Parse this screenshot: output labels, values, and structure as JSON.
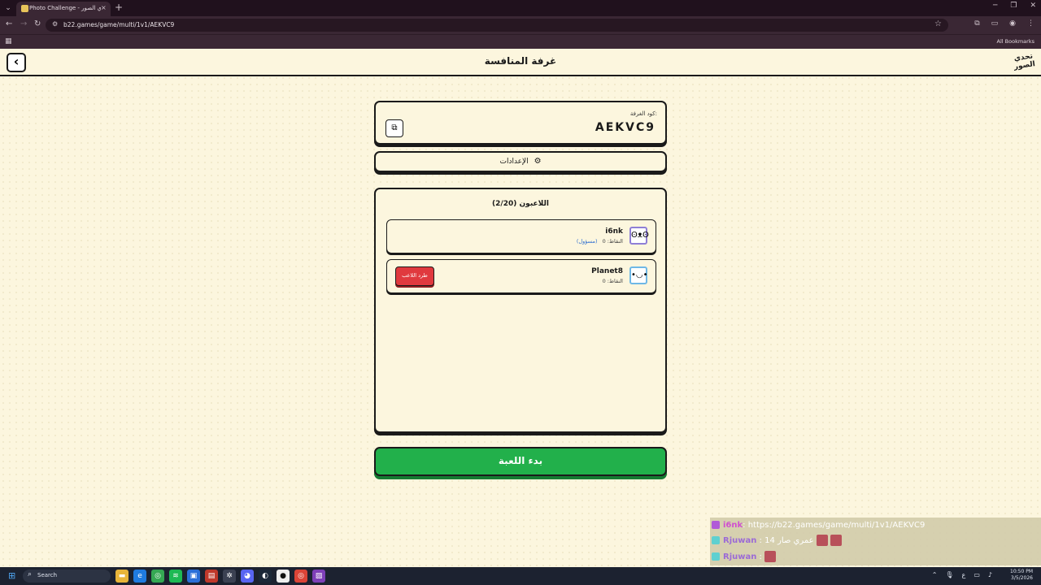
{
  "browser": {
    "tab_title": "Photo Challenge - تحدي الصور",
    "tab_close": "×",
    "new_tab": "+",
    "url": "b22.games/game/multi/1v1/AEKVC9",
    "all_bookmarks": "All Bookmarks"
  },
  "header": {
    "title": "غرفة المنافسة",
    "logo_line1": "تحدي",
    "logo_line2": "الصور"
  },
  "room": {
    "code_label": "كود الغرفة:",
    "code_value": "AEKVC9"
  },
  "settings_label": "الإعدادات",
  "players": {
    "title": "اللاعبون (2/20)",
    "list": [
      {
        "name": "i6nk",
        "points": "النقاط: 0",
        "host": "(مسؤول)"
      },
      {
        "name": "Planet8",
        "points": "النقاط: 0",
        "kick": "طرد اللاعب"
      }
    ]
  },
  "start_button": "بدء اللعبة",
  "chat": [
    {
      "user": "i6nk",
      "text": ": https://b22.games/game/multi/1v1/AEKVC9"
    },
    {
      "user": "Rjuwan",
      "text": " : 14 عمري صار"
    },
    {
      "user": "Rjuwan",
      "text": " :"
    }
  ],
  "taskbar": {
    "search": "Search",
    "time": "10:50 PM",
    "date": "3/5/2026",
    "lang": "ع"
  }
}
